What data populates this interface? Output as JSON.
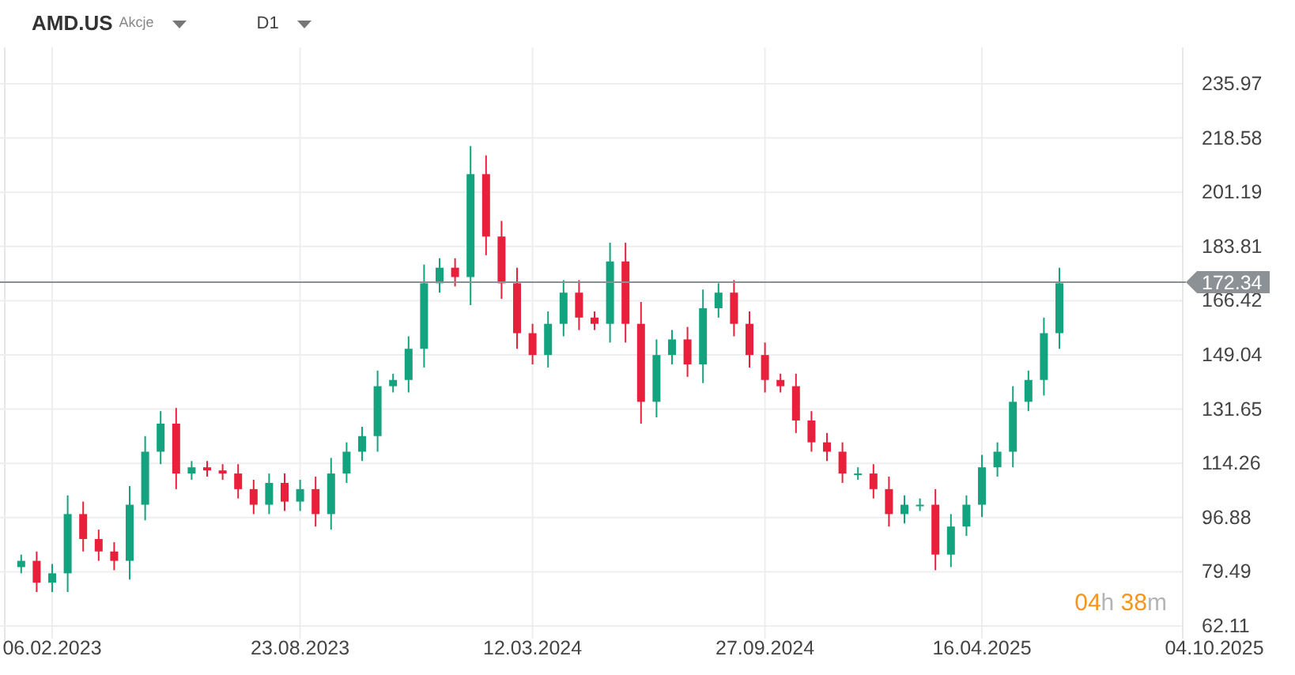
{
  "header": {
    "symbol": "AMD.US",
    "asset_type": "Akcje",
    "interval": "D1"
  },
  "chart": {
    "chart_data": {
      "type": "candlestick",
      "grid": true,
      "ylim": [
        62.11,
        235.97
      ],
      "yticks": [
        235.97,
        218.58,
        201.19,
        183.81,
        166.42,
        149.04,
        131.65,
        114.26,
        96.88,
        79.49,
        62.11
      ],
      "categories": [
        null,
        null,
        "06.02.2023",
        null,
        null,
        null,
        null,
        null,
        null,
        null,
        null,
        null,
        null,
        null,
        null,
        null,
        null,
        null,
        "23.08.2023",
        null,
        null,
        null,
        null,
        null,
        null,
        null,
        null,
        null,
        null,
        null,
        null,
        null,
        null,
        "12.03.2024",
        null,
        null,
        null,
        null,
        null,
        null,
        null,
        null,
        null,
        null,
        null,
        null,
        null,
        null,
        "27.09.2024",
        null,
        null,
        null,
        null,
        null,
        null,
        null,
        null,
        null,
        null,
        null,
        null,
        null,
        "16.04.2025",
        null,
        null,
        null,
        null,
        null,
        null,
        null,
        null,
        null,
        null,
        null,
        null,
        null,
        null,
        "04.10.2025"
      ],
      "ohlc": [
        [
          81,
          85,
          79,
          83
        ],
        [
          83,
          86,
          73,
          76
        ],
        [
          76,
          82,
          73,
          79
        ],
        [
          79,
          104,
          73,
          98
        ],
        [
          98,
          102,
          86,
          90
        ],
        [
          90,
          93,
          83,
          86
        ],
        [
          86,
          89,
          80,
          83
        ],
        [
          83,
          107,
          77,
          101
        ],
        [
          101,
          123,
          96,
          118
        ],
        [
          118,
          131,
          114,
          127
        ],
        [
          127,
          132,
          106,
          111
        ],
        [
          111,
          115,
          109,
          113
        ],
        [
          113,
          115,
          110,
          112
        ],
        [
          112,
          114,
          109,
          111
        ],
        [
          111,
          114,
          103,
          106
        ],
        [
          106,
          109,
          98,
          101
        ],
        [
          101,
          111,
          98,
          108
        ],
        [
          108,
          111,
          99,
          102
        ],
        [
          102,
          109,
          99,
          106
        ],
        [
          106,
          110,
          94,
          98
        ],
        [
          98,
          116,
          93,
          111
        ],
        [
          111,
          121,
          108,
          118
        ],
        [
          118,
          126,
          115,
          123
        ],
        [
          123,
          144,
          118,
          139
        ],
        [
          139,
          143,
          137,
          141
        ],
        [
          141,
          155,
          137,
          151
        ],
        [
          151,
          178,
          145,
          172
        ],
        [
          172,
          180,
          169,
          177
        ],
        [
          177,
          180,
          171,
          174
        ],
        [
          174,
          216,
          165,
          207
        ],
        [
          207,
          213,
          181,
          187
        ],
        [
          187,
          192,
          167,
          172
        ],
        [
          172,
          177,
          151,
          156
        ],
        [
          156,
          159,
          146,
          149
        ],
        [
          149,
          163,
          145,
          159
        ],
        [
          159,
          173,
          155,
          169
        ],
        [
          169,
          173,
          157,
          161
        ],
        [
          161,
          163,
          157,
          159
        ],
        [
          159,
          185,
          153,
          179
        ],
        [
          179,
          185,
          153,
          159
        ],
        [
          159,
          166,
          127,
          134
        ],
        [
          134,
          154,
          129,
          149
        ],
        [
          149,
          157,
          146,
          154
        ],
        [
          154,
          158,
          142,
          146
        ],
        [
          146,
          170,
          140,
          164
        ],
        [
          164,
          172,
          161,
          169
        ],
        [
          169,
          173,
          155,
          159
        ],
        [
          159,
          163,
          145,
          149
        ],
        [
          149,
          153,
          137,
          141
        ],
        [
          141,
          143,
          137,
          139
        ],
        [
          139,
          143,
          124,
          128
        ],
        [
          128,
          131,
          118,
          121
        ],
        [
          121,
          124,
          115,
          118
        ],
        [
          118,
          121,
          108,
          111
        ],
        [
          111,
          113,
          109,
          111
        ],
        [
          111,
          114,
          103,
          106
        ],
        [
          106,
          110,
          94,
          98
        ],
        [
          98,
          104,
          95,
          101
        ],
        [
          101,
          103,
          99,
          101
        ],
        [
          101,
          106,
          80,
          85
        ],
        [
          85,
          98,
          81,
          94
        ],
        [
          94,
          104,
          91,
          101
        ],
        [
          101,
          117,
          97,
          113
        ],
        [
          113,
          121,
          110,
          118
        ],
        [
          118,
          139,
          113,
          134
        ],
        [
          134,
          144,
          131,
          141
        ],
        [
          141,
          161,
          136,
          156
        ],
        [
          156,
          177,
          151,
          172
        ],
        null,
        null,
        null,
        null,
        null,
        null,
        null,
        null,
        null,
        null
      ],
      "ref_lines": [
        {
          "axis": "y",
          "value": 172.34,
          "label": "172.34"
        }
      ]
    },
    "countdown": [
      {
        "text": "04",
        "kind": "number"
      },
      {
        "text": "h",
        "kind": "unit"
      },
      {
        "text": " 38",
        "kind": "number"
      },
      {
        "text": "m",
        "kind": "unit"
      }
    ]
  }
}
